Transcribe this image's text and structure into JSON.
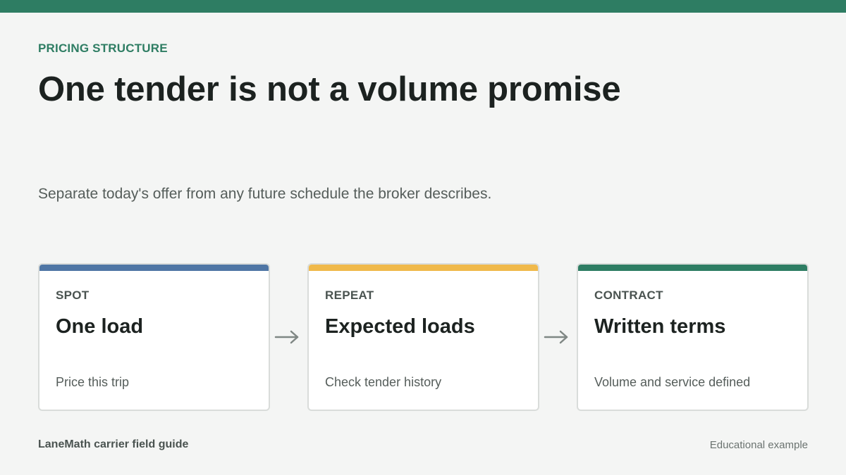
{
  "header": {
    "eyebrow": "PRICING STRUCTURE",
    "title": "One tender is not a volume promise",
    "subtitle": "Separate today's offer from any future schedule the broker describes."
  },
  "cards": [
    {
      "kicker": "SPOT",
      "heading": "One load",
      "note": "Price this trip",
      "accent": "#4f76a5"
    },
    {
      "kicker": "REPEAT",
      "heading": "Expected loads",
      "note": "Check tender history",
      "accent": "#f0b94a"
    },
    {
      "kicker": "CONTRACT",
      "heading": "Written terms",
      "note": "Volume and service defined",
      "accent": "#2e7d63"
    }
  ],
  "arrows": [
    {
      "icon": "arrow-right-icon"
    },
    {
      "icon": "arrow-right-icon"
    }
  ],
  "footer": {
    "brand": "LaneMath carrier field guide",
    "disclaimer": "Educational example"
  },
  "colors": {
    "brand_green": "#2e7d63",
    "background": "#f4f5f4",
    "arrow": "#7f8784"
  }
}
